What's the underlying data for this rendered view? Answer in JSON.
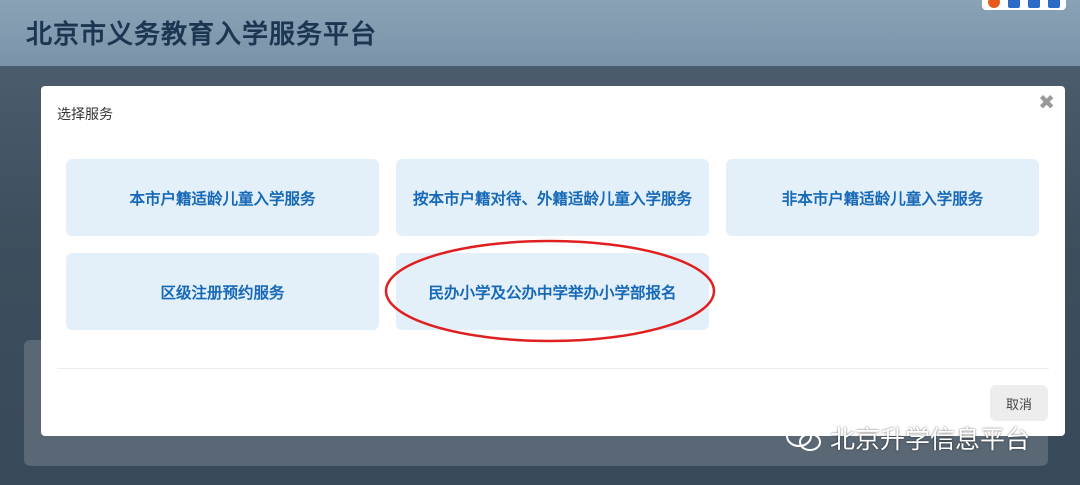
{
  "page": {
    "title": "北京市义务教育入学服务平台"
  },
  "modal": {
    "title": "选择服务",
    "close_symbol": "✖",
    "services": [
      {
        "label": "本市户籍适龄儿童入学服务"
      },
      {
        "label": "按本市户籍对待、外籍适龄儿童入学服务"
      },
      {
        "label": "非本市户籍适龄儿童入学服务"
      },
      {
        "label": "区级注册预约服务"
      },
      {
        "label": "民办小学及公办中学举办小学部报名"
      }
    ],
    "cancel_label": "取消"
  },
  "watermark": {
    "text": "北京升学信息平台",
    "icon": "wechat-icon"
  },
  "colors": {
    "accent": "#1769b8",
    "card_bg": "#e3f0fa",
    "highlight_ellipse": "#e02020"
  }
}
